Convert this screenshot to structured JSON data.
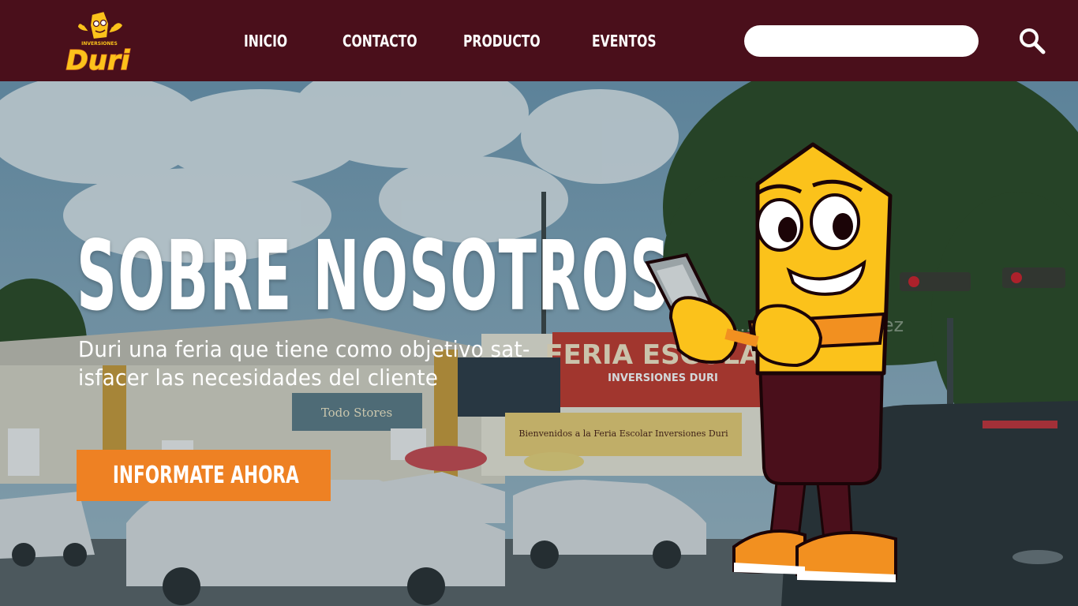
{
  "brand": {
    "logo_small": "INVERSIONES",
    "logo_main": "Duri"
  },
  "nav": {
    "items": [
      "INICIO",
      "CONTACTO",
      "PRODUCTO",
      "EVENTOS"
    ]
  },
  "search": {
    "value": "",
    "placeholder": "",
    "icon": "search-icon"
  },
  "hero": {
    "title": "SOBRE NOSOTROS",
    "description": "Duri una feria que tiene como objetivo sat-isfacer las necesidades del cliente",
    "cta_label": "INFORMATE AHORA",
    "background_overlay_text": "tu... ...far Ali Gómez"
  },
  "photo_signs": {
    "main_sign": "FERIA ESCOLAR",
    "main_sign_sub": "INVERSIONES DURI",
    "welcome_banner": "Bienvenidos a la Feria Escolar Inversiones Duri",
    "shop_sign": "Todo Stores"
  },
  "colors": {
    "header_bg": "#4a0f1b",
    "cta_bg": "#ee8123",
    "mascot_yellow": "#fbc21b",
    "mascot_maroon": "#4a0f1b",
    "mascot_orange": "#f29020"
  }
}
